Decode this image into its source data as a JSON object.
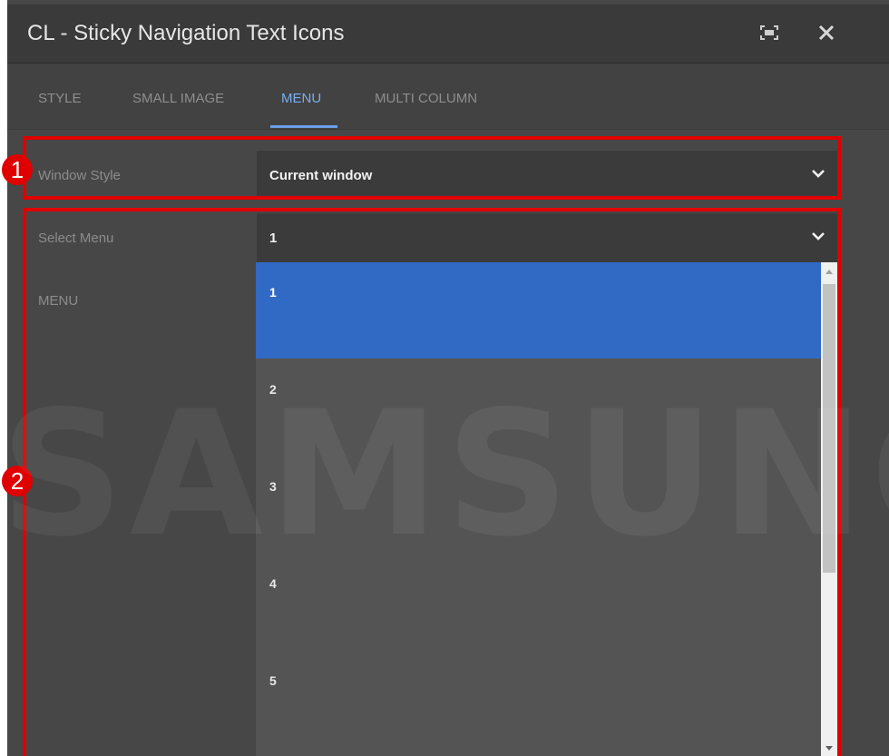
{
  "window": {
    "title": "CL - Sticky Navigation Text Icons",
    "icons": [
      "fullscreen-icon",
      "close-icon"
    ]
  },
  "tabs": [
    {
      "label": "STYLE",
      "active": false
    },
    {
      "label": "SMALL IMAGE",
      "active": false
    },
    {
      "label": "MENU",
      "active": true
    },
    {
      "label": "MULTI COLUMN",
      "active": false
    }
  ],
  "form": {
    "window_style": {
      "label": "Window Style",
      "value": "Current window"
    },
    "select_menu": {
      "label": "Select Menu",
      "value": "1",
      "options": [
        "1",
        "2",
        "3",
        "4",
        "5"
      ],
      "selected_index": 0
    },
    "menu_label": "MENU"
  },
  "annotations": {
    "badge_1": "1",
    "badge_2": "2"
  },
  "watermark": "SAMSUNG",
  "colors": {
    "highlight": "#e00000",
    "accent_tab": "#78aef0",
    "selected_option": "#316ac5"
  }
}
